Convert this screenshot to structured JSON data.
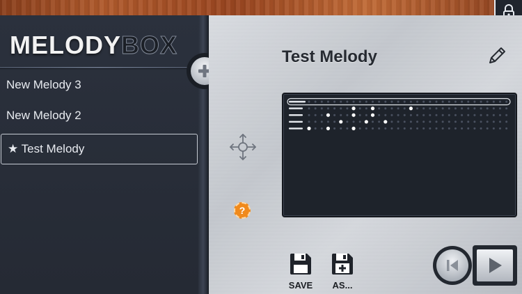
{
  "app": {
    "logo_part1": "MELODY",
    "logo_part2": "BOX"
  },
  "sidebar": {
    "items": [
      {
        "label": "New Melody 3",
        "selected": false
      },
      {
        "label": "New Melody 2",
        "selected": false
      },
      {
        "label": "★ Test Melody",
        "selected": true
      }
    ]
  },
  "editor": {
    "title": "Test Melody",
    "help_label": "?",
    "note_grid": {
      "rows": 5,
      "columns": 32,
      "highlighted_row": 1,
      "active_notes": [
        {
          "row": 1,
          "col": 7
        },
        {
          "row": 1,
          "col": 10
        },
        {
          "row": 1,
          "col": 16
        },
        {
          "row": 2,
          "col": 3
        },
        {
          "row": 2,
          "col": 7
        },
        {
          "row": 2,
          "col": 10
        },
        {
          "row": 3,
          "col": 5
        },
        {
          "row": 3,
          "col": 9
        },
        {
          "row": 3,
          "col": 12
        },
        {
          "row": 4,
          "col": 0
        },
        {
          "row": 4,
          "col": 3
        },
        {
          "row": 4,
          "col": 7
        }
      ]
    }
  },
  "toolbar": {
    "save_label": "SAVE",
    "save_as_label": "AS..."
  },
  "icons": {
    "lock": "lock-icon",
    "add": "plus-icon",
    "pencil": "pencil-icon",
    "move": "move-icon",
    "help": "question-icon",
    "save": "floppy-disk-icon",
    "save_as": "floppy-disk-plus-icon",
    "rewind": "skip-back-icon",
    "play": "play-icon"
  },
  "colors": {
    "accent_help": "#f08a1c",
    "panel_dark": "#1e232b",
    "note_active": "#ffffff",
    "note_inactive": "#4a5160"
  }
}
